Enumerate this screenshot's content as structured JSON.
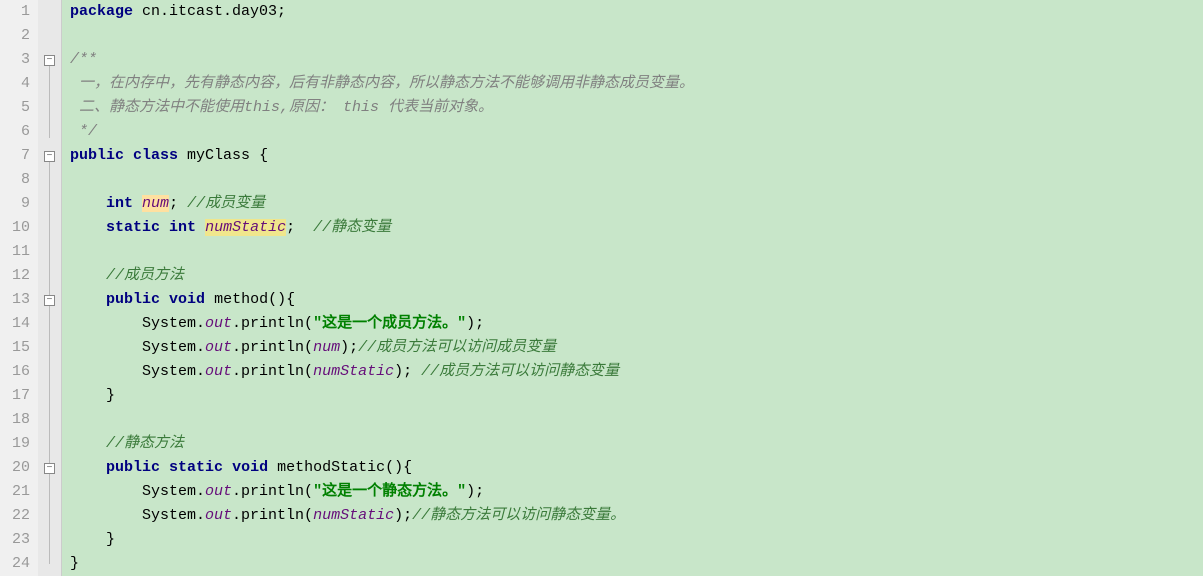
{
  "lines": {
    "l1": {
      "n": "1",
      "package": "package",
      "pkg": " cn.itcast.day03;"
    },
    "l2": {
      "n": "2"
    },
    "l3": {
      "n": "3",
      "c": "/**"
    },
    "l4": {
      "n": "4",
      "c": " 一，在内存中，先有静态内容，后有非静态内容，所以静态方法不能够调用非静态成员变量。"
    },
    "l5": {
      "n": "5",
      "c": " 二、静态方法中不能使用this,原因： this 代表当前对象。"
    },
    "l6": {
      "n": "6",
      "c": " */"
    },
    "l7": {
      "n": "7",
      "public": "public",
      "class": "class",
      "name": " myClass ",
      "brace": "{"
    },
    "l8": {
      "n": "8"
    },
    "l9": {
      "n": "9",
      "kw_int": "int",
      "sp1": " ",
      "var": "num",
      "semi": "; ",
      "c": "//成员变量"
    },
    "l10": {
      "n": "10",
      "kw_static": "static",
      "sp1": " ",
      "kw_int": "int",
      "sp2": " ",
      "var": "numStatic",
      "semi": ";  ",
      "c": "//静态变量"
    },
    "l11": {
      "n": "11"
    },
    "l12": {
      "n": "12",
      "c": "//成员方法"
    },
    "l13": {
      "n": "13",
      "public": "public",
      "void": "void",
      "rest": " method(){"
    },
    "l14": {
      "n": "14",
      "pre": "System.",
      "out": "out",
      "mid": ".println(",
      "str": "\"这是一个成员方法。\"",
      "post": ");"
    },
    "l15": {
      "n": "15",
      "pre": "System.",
      "out": "out",
      "mid": ".println(",
      "arg": "num",
      "post": ");",
      "c": "//成员方法可以访问成员变量"
    },
    "l16": {
      "n": "16",
      "pre": "System.",
      "out": "out",
      "mid": ".println(",
      "arg": "numStatic",
      "post": "); ",
      "c": "//成员方法可以访问静态变量"
    },
    "l17": {
      "n": "17",
      "brace": "}"
    },
    "l18": {
      "n": "18"
    },
    "l19": {
      "n": "19",
      "c": "//静态方法"
    },
    "l20": {
      "n": "20",
      "public": "public",
      "static": "static",
      "void": "void",
      "rest": " methodStatic(){"
    },
    "l21": {
      "n": "21",
      "pre": "System.",
      "out": "out",
      "mid": ".println(",
      "str": "\"这是一个静态方法。\"",
      "post": ");"
    },
    "l22": {
      "n": "22",
      "pre": "System.",
      "out": "out",
      "mid": ".println(",
      "arg": "numStatic",
      "post": ");",
      "c": "//静态方法可以访问静态变量。"
    },
    "l23": {
      "n": "23",
      "brace": "}"
    },
    "l24": {
      "n": "24",
      "brace": "}"
    }
  }
}
